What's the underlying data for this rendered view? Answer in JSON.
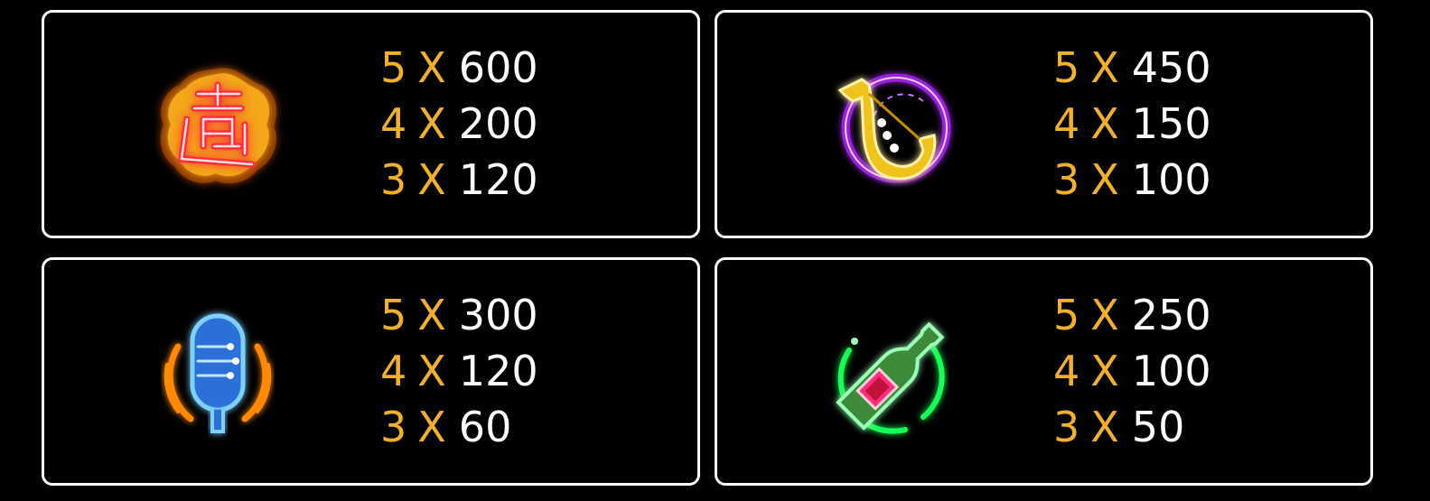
{
  "colors": {
    "background": "#000000",
    "border": "#ffffff",
    "count_color": "#f2b12a",
    "amount_color": "#ffffff"
  },
  "symbols": [
    {
      "icon": "neon-chinese-character-icon",
      "rows": [
        {
          "count": "5",
          "x": "X",
          "amount": "600"
        },
        {
          "count": "4",
          "x": "X",
          "amount": "200"
        },
        {
          "count": "3",
          "x": "X",
          "amount": "120"
        }
      ]
    },
    {
      "icon": "neon-saxophone-icon",
      "rows": [
        {
          "count": "5",
          "x": "X",
          "amount": "450"
        },
        {
          "count": "4",
          "x": "X",
          "amount": "150"
        },
        {
          "count": "3",
          "x": "X",
          "amount": "100"
        }
      ]
    },
    {
      "icon": "neon-microphone-icon",
      "rows": [
        {
          "count": "5",
          "x": "X",
          "amount": "300"
        },
        {
          "count": "4",
          "x": "X",
          "amount": "120"
        },
        {
          "count": "3",
          "x": "X",
          "amount": "60"
        }
      ]
    },
    {
      "icon": "neon-bottle-icon",
      "rows": [
        {
          "count": "5",
          "x": "X",
          "amount": "250"
        },
        {
          "count": "4",
          "x": "X",
          "amount": "100"
        },
        {
          "count": "3",
          "x": "X",
          "amount": "50"
        }
      ]
    }
  ]
}
